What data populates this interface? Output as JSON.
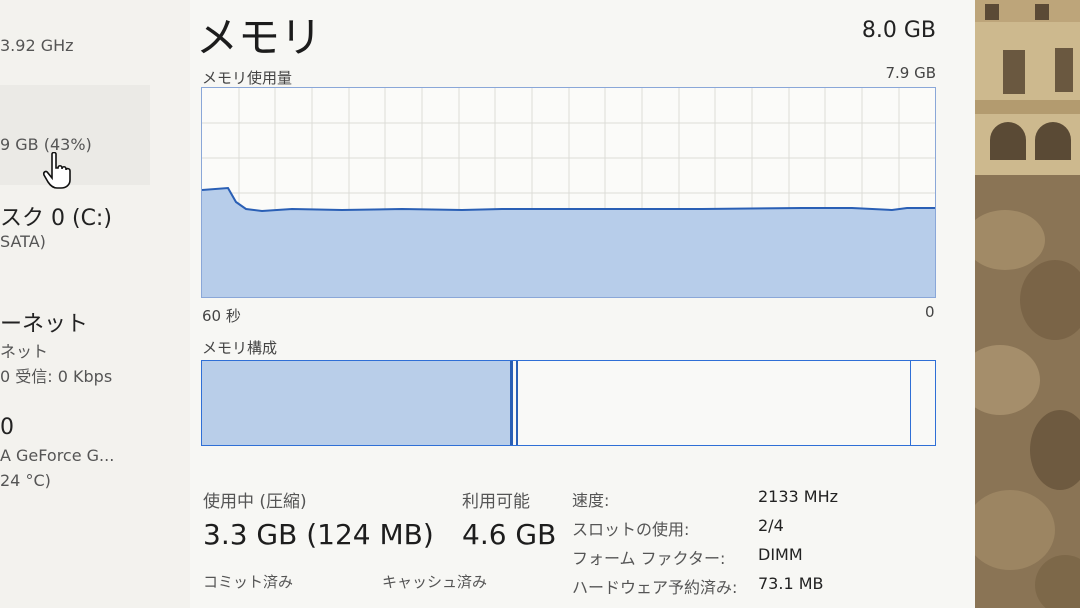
{
  "sidebar": {
    "cpu_speed": "3.92 GHz",
    "memory_detail": "9 GB (43%)",
    "disk_name": "スク 0 (C:)",
    "disk_type": "SATA)",
    "network_name": "ーネット",
    "network_sub": "ネット",
    "network_stats": "0 受信: 0 Kbps",
    "gpu_name": "0",
    "gpu_model": "A GeForce G...",
    "gpu_temp": "24 °C)"
  },
  "memory": {
    "title": "メモリ",
    "total": "8.0 GB",
    "usage_graph": {
      "label": "メモリ使用量",
      "max": "7.9 GB",
      "time_left": "60 秒",
      "time_right": "0"
    },
    "composition": {
      "label": "メモリ構成",
      "in_use_fraction": 0.42,
      "modified_fraction": 0.004,
      "free_fraction": 0.966
    },
    "stats": {
      "in_use_label": "使用中 (圧縮)",
      "in_use_value": "3.3 GB (124 MB)",
      "available_label": "利用可能",
      "available_value": "4.6 GB",
      "committed_label": "コミット済み",
      "cached_label": "キャッシュ済み"
    },
    "details": [
      {
        "label": "速度:",
        "value": "2133 MHz"
      },
      {
        "label": "スロットの使用:",
        "value": "2/4"
      },
      {
        "label": "フォーム ファクター:",
        "value": "DIMM"
      },
      {
        "label": "ハードウェア予約済み:",
        "value": "73.1 MB"
      }
    ]
  },
  "colors": {
    "graph_fill": "#b7cdea",
    "graph_line": "#2a5fb5",
    "graph_border": "#8aa7d8"
  }
}
